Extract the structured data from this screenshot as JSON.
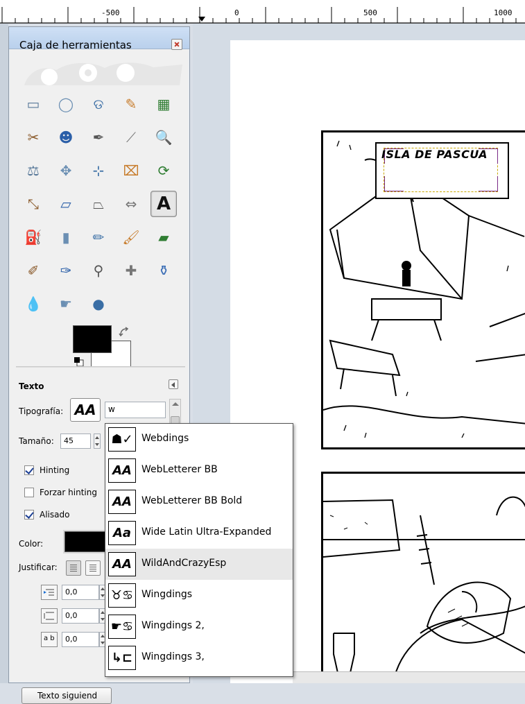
{
  "ruler": {
    "labels": [
      "-500",
      "0",
      "500",
      "1000"
    ]
  },
  "toolbox": {
    "title": "Caja de herramientas",
    "tools": [
      "rect-select-icon",
      "ellipse-select-icon",
      "free-select-icon",
      "fuzzy-select-icon",
      "color-select-icon",
      "scissors-select-icon",
      "foreground-select-icon",
      "paths-icon",
      "color-picker-icon",
      "zoom-icon",
      "measure-icon",
      "move-icon",
      "alignment-icon",
      "crop-icon",
      "rotate-icon",
      "scale-icon",
      "shear-icon",
      "perspective-icon",
      "flip-icon",
      "text-icon",
      "bucket-fill-icon",
      "blend-icon",
      "pencil-icon",
      "paintbrush-icon",
      "eraser-icon",
      "airbrush-icon",
      "ink-icon",
      "clone-icon",
      "heal-icon",
      "perspective-clone-icon",
      "blur-icon",
      "smudge-icon",
      "dodge-burn-icon"
    ],
    "active_tool": "text-icon"
  },
  "colors": {
    "foreground": "#000000",
    "background": "#ffffff"
  },
  "text_options": {
    "title": "Texto",
    "font_label": "Tipografía:",
    "font_preview": "AA",
    "font_input_value": "w",
    "size_label": "Tamaño:",
    "size_value": "45",
    "hinting_label": "Hinting",
    "hinting_checked": true,
    "force_hinting_label": "Forzar hinting",
    "force_hinting_checked": false,
    "antialias_label": "Alisado",
    "antialias_checked": true,
    "color_label": "Color:",
    "justify_label": "Justificar:",
    "indent_value": "0,0",
    "line_spacing_value": "0,0",
    "letter_spacing_value": "0,0",
    "letter_spacing_icon_text": "a b",
    "follow_path_label": "Texto siguiend"
  },
  "font_dropdown": {
    "items": [
      {
        "label": "Webdings",
        "preview": "☗✓",
        "highlighted": false
      },
      {
        "label": "WebLetterer BB",
        "preview": "AA",
        "highlighted": false
      },
      {
        "label": "WebLetterer BB Bold",
        "preview": "AA",
        "highlighted": false
      },
      {
        "label": "Wide Latin Ultra-Expanded",
        "preview": "Aa",
        "highlighted": false
      },
      {
        "label": "WildAndCrazyEsp",
        "preview": "AA",
        "highlighted": true
      },
      {
        "label": "Wingdings",
        "preview": "♉♋",
        "highlighted": false
      },
      {
        "label": "Wingdings 2,",
        "preview": "☛♋",
        "highlighted": false
      },
      {
        "label": "Wingdings 3,",
        "preview": "↳⊏",
        "highlighted": false
      }
    ]
  },
  "canvas": {
    "sign_text": "ISLA DE PASCUA"
  }
}
